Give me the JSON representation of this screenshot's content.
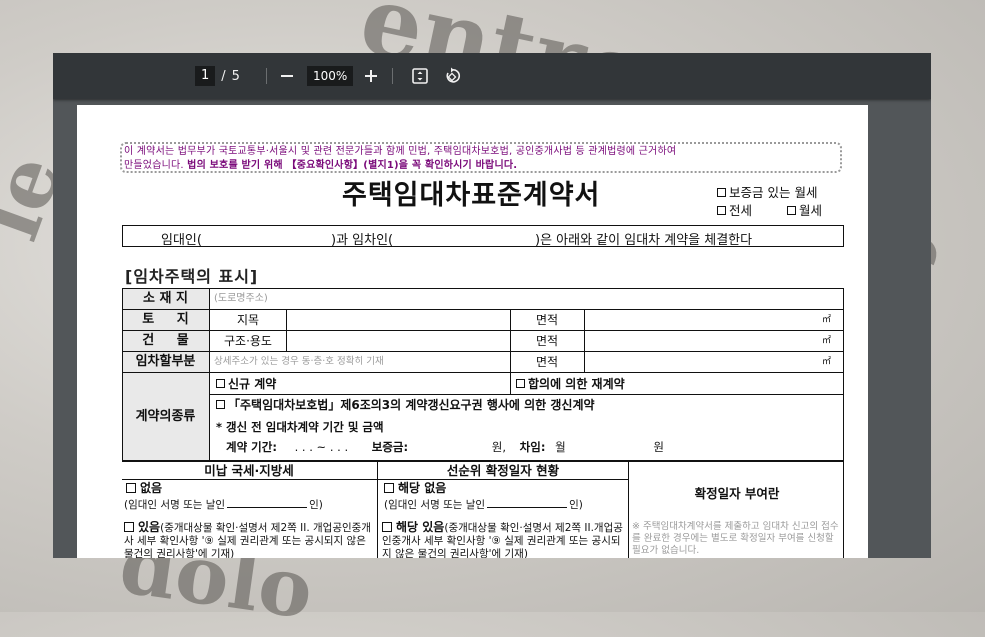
{
  "toolbar": {
    "page_current": "1",
    "page_separator": "/",
    "page_total": "5",
    "zoom": "100%"
  },
  "document": {
    "notice_line1": "이 계약서는 법무부가 국토교통부·서울시 및 관련 전문가들과 함께 민법, 주택임대차보호법, 공인중개사법 등 관계법령에 근거하여",
    "notice_line2_plain": "만들었습니다. ",
    "notice_line2_bold": "법의 보호를 받기 위해 【중요확인사항】(별지1)을 꼭 확인하시기 바랍니다.",
    "title": "주택임대차표준계약서",
    "option_monthly_deposit": "보증금 있는 월세",
    "option_jeonse": "전세",
    "option_monthly": "월세",
    "parties_landlord": "임대인(",
    "parties_tenant": ")과 임차인(",
    "parties_rest": ")은 아래와 같이 임대차 계약을 체결한다",
    "section_title": "[임차주택의 표시]",
    "row_location_label": "소 재 지",
    "row_location_hint": "(도로명주소)",
    "row_land_label": "토     지",
    "row_land_sub": "지목",
    "row_area_label": "면적",
    "unit_m2": "㎡",
    "row_building_label": "건     물",
    "row_building_sub": "구조·용도",
    "row_part_label": "임차할부분",
    "row_part_hint": "상세주소가 있는 경우 동·층·호 정확히 기재",
    "contract_type_label": "계약의종류",
    "ct_new": "신규 계약",
    "ct_agreed": "합의에 의한 재계약",
    "ct_renewal": "「주택임대차보호법」제6조의3의 계약갱신요구권 행사에 의한 갱신계약",
    "ct_before": "* 갱신 전 임대차계약 기간 및 금액",
    "ct_period": "계약 기간:",
    "ct_period_dots": ".      .      . ~      .      .      .",
    "ct_deposit": "보증금:",
    "ct_won1": "원,",
    "ct_rent": "차임:",
    "ct_monthly": "월",
    "ct_won2": "원",
    "tax_header": "미납 국세·지방세",
    "priority_header": "선순위 확정일자 현황",
    "confirm_header": "확정일자 부여란",
    "none_label": "없음",
    "none_sign": "(임대인 서명 또는 날인",
    "none_sign_end": "인)",
    "exists_label": "있음",
    "exists_text": "(중개대상물 확인·설명서 제2쪽 II. 개업공인중개사 세부 확인사항 '⑨ 실제 권리관계 또는 공시되지 않은 물건의 권리사항'에 기재)",
    "pr_none_label": "해당 없음",
    "pr_exists_label": "해당 있음",
    "pr_exists_text": "(중개대상물 확인·설명서 제2쪽 II.개업공인중개사 세부 확인사항 '⑨ 실제 권리관계 또는 공시되지 않은 물건의 권리사항'에 기재)",
    "confirm_note": "※ 주택임대차계약서를 제출하고 임대차 신고의 접수를 완료한 경우에는 별도로 확정일자 부여를 신청할 필요가 없습니다."
  }
}
